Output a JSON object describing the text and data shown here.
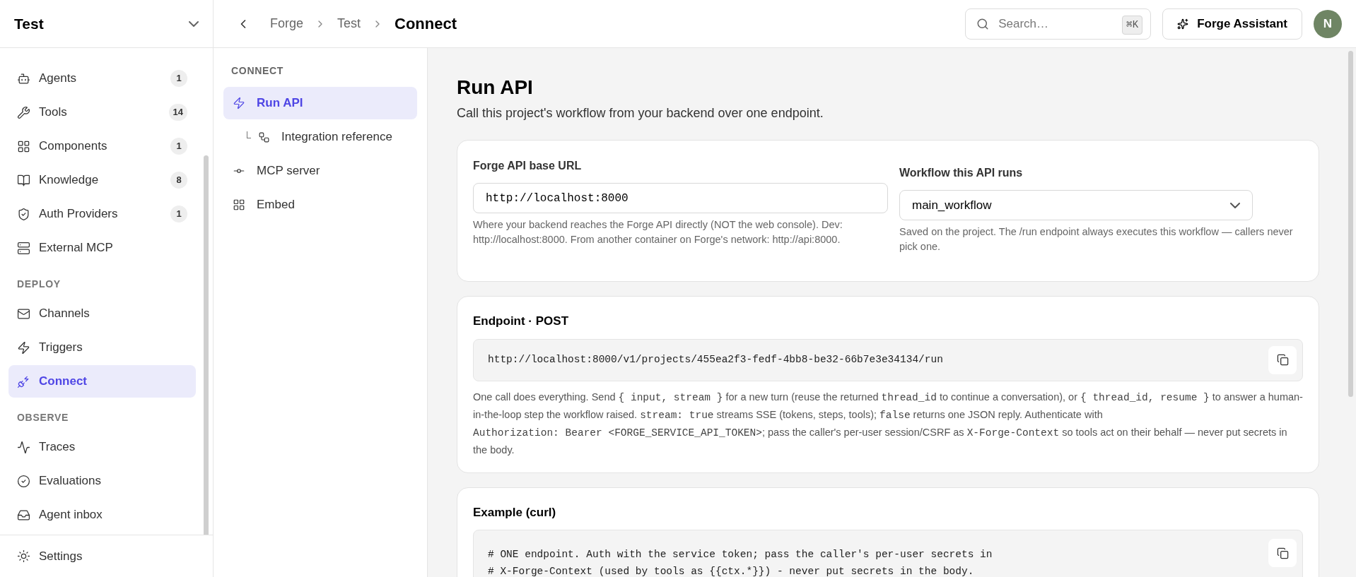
{
  "sidebar": {
    "project": "Test",
    "sections": [
      {
        "items": [
          {
            "label": "Agents",
            "count": "1",
            "selected": false
          },
          {
            "label": "Tools",
            "count": "14",
            "selected": false
          },
          {
            "label": "Components",
            "count": "1",
            "selected": false
          },
          {
            "label": "Knowledge",
            "count": "8",
            "selected": false
          },
          {
            "label": "Auth Providers",
            "count": "1",
            "selected": false
          },
          {
            "label": "External MCP",
            "selected": false
          }
        ]
      },
      {
        "heading": "DEPLOY",
        "items": [
          {
            "label": "Channels",
            "selected": false
          },
          {
            "label": "Triggers",
            "selected": false
          },
          {
            "label": "Connect",
            "selected": true
          }
        ]
      },
      {
        "heading": "OBSERVE",
        "items": [
          {
            "label": "Traces",
            "selected": false
          },
          {
            "label": "Evaluations",
            "selected": false
          },
          {
            "label": "Agent inbox",
            "selected": false
          }
        ]
      }
    ],
    "footer_item": {
      "label": "Settings"
    }
  },
  "header": {
    "breadcrumbs": [
      "Forge",
      "Test",
      "Connect"
    ],
    "search": {
      "placeholder": "Search…",
      "shortcut": "⌘K"
    },
    "assistant_button": "Forge Assistant",
    "avatar": "N"
  },
  "subnav": {
    "heading": "CONNECT",
    "items": [
      {
        "label": "Run API",
        "selected": true,
        "children": [
          {
            "label": "Integration reference",
            "selected": false
          }
        ]
      },
      {
        "label": "MCP server",
        "selected": false
      },
      {
        "label": "Embed",
        "selected": false
      }
    ]
  },
  "page": {
    "title": "Run API",
    "subtitle": "Call this project's workflow from your backend over one endpoint.",
    "base_url": {
      "label": "Forge API base URL",
      "value": "http://localhost:8000",
      "help": "Where your backend reaches the Forge API directly (NOT the web console). Dev: http://localhost:8000. From another container on Forge's network: http://api:8000."
    },
    "workflow": {
      "label": "Workflow this API runs",
      "value": "main_workflow",
      "help": "Saved on the project. The /run endpoint always executes this workflow — callers never pick one."
    },
    "endpoint": {
      "title": "Endpoint · POST",
      "url": "http://localhost:8000/v1/projects/455ea2f3-fedf-4bb8-be32-66b7e3e34134/run",
      "description": [
        {
          "kind": "text",
          "text": "One call does everything. Send "
        },
        {
          "kind": "code",
          "text": "{ input, stream }"
        },
        {
          "kind": "text",
          "text": " for a new turn (reuse the returned "
        },
        {
          "kind": "code",
          "text": "thread_id"
        },
        {
          "kind": "text",
          "text": " to continue a conversation), or "
        },
        {
          "kind": "code",
          "text": "{ thread_id, resume }"
        },
        {
          "kind": "text",
          "text": " to answer a human-in-the-loop step the workflow raised. "
        },
        {
          "kind": "code",
          "text": "stream: true"
        },
        {
          "kind": "text",
          "text": " streams SSE (tokens, steps, tools); "
        },
        {
          "kind": "code",
          "text": "false"
        },
        {
          "kind": "text",
          "text": " returns one JSON reply. Authenticate with "
        },
        {
          "kind": "code",
          "text": "Authorization: Bearer <FORGE_SERVICE_API_TOKEN>"
        },
        {
          "kind": "text",
          "text": "; pass the caller's per-user session/CSRF as "
        },
        {
          "kind": "code",
          "text": "X-Forge-Context"
        },
        {
          "kind": "text",
          "text": " so tools act on their behalf — never put secrets in the body."
        }
      ]
    },
    "example": {
      "title": "Example (curl)",
      "code_lines": [
        "# ONE endpoint. Auth with the service token; pass the caller's per-user secrets in",
        "# X-Forge-Context (used by tools as {{ctx.*}}) - never put secrets in the body."
      ]
    }
  }
}
